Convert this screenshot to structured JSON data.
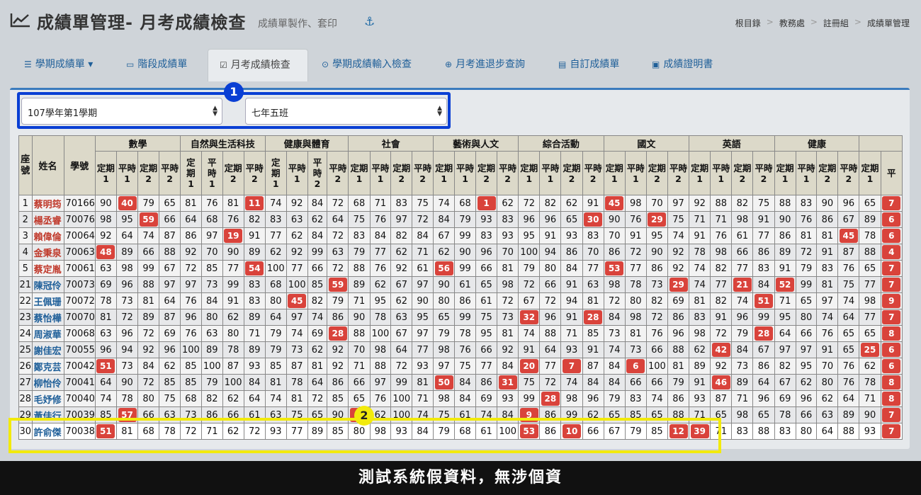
{
  "header": {
    "title": "成績單管理- 月考成績檢查",
    "subtitle": "成績單製作、套印",
    "anchor": "⚓",
    "crumbs": [
      "根目錄",
      "教務處",
      "註冊組",
      "成績單管理"
    ]
  },
  "tabs": [
    {
      "label": "學期成績單",
      "icon": "list-icon",
      "caret": "▾"
    },
    {
      "label": "階段成績單",
      "icon": "card-icon"
    },
    {
      "label": "月考成績檢查",
      "icon": "checkbox-icon"
    },
    {
      "label": "學期成績輸入檢查",
      "icon": "check-circle-icon"
    },
    {
      "label": "月考進退步查詢",
      "icon": "zoom-icon"
    },
    {
      "label": "自訂成績單",
      "icon": "form-icon"
    },
    {
      "label": "成績證明書",
      "icon": "id-icon"
    }
  ],
  "filters": {
    "term": "107學年第1學期",
    "klass": "七年五班"
  },
  "badges": {
    "one": "1",
    "two": "2"
  },
  "table": {
    "seat_header": "座號",
    "name_header": "姓名",
    "id_header": "學號",
    "subjects": [
      "數學",
      "自然與生活科技",
      "健康與體育",
      "社會",
      "藝術與人文",
      "綜合活動",
      "國文",
      "英語",
      "健康",
      ""
    ],
    "sub_headers": [
      "定期 1",
      "平時 1",
      "定期 2",
      "平時 2",
      "定 期 1",
      "平 時 1",
      "定期 2",
      "平時 2",
      "定 期 1",
      "平時 1",
      "平 時 2",
      "平時 2",
      "定期 1",
      "平時 1",
      "定期 2",
      "平時 2",
      "定期 1",
      "平時 1",
      "定期 2",
      "平時 2",
      "定期 1",
      "平時 1",
      "定期 2",
      "平時 2",
      "定期 1",
      "平時 1",
      "定期 2",
      "平時 2",
      "定期 1",
      "平時 1",
      "定期 2",
      "平時 2",
      "定期 1",
      "平時 1",
      "定期 2",
      "平時 2",
      "定期 1",
      "平"
    ],
    "rows": [
      {
        "seat": "1",
        "name": "蔡明筠",
        "id": "70166",
        "red": true,
        "scores": [
          "90",
          "40",
          "79",
          "65",
          "81",
          "76",
          "81",
          "11",
          "74",
          "92",
          "84",
          "72",
          "68",
          "71",
          "83",
          "75",
          "74",
          "68",
          "1",
          "62",
          "72",
          "82",
          "62",
          "91",
          "45",
          "98",
          "70",
          "97",
          "92",
          "88",
          "82",
          "75",
          "88",
          "83",
          "90",
          "96",
          "65",
          "7"
        ]
      },
      {
        "seat": "2",
        "name": "楊丞睿",
        "id": "70076",
        "red": true,
        "scores": [
          "98",
          "95",
          "59",
          "66",
          "64",
          "68",
          "76",
          "82",
          "83",
          "63",
          "62",
          "64",
          "75",
          "76",
          "97",
          "72",
          "84",
          "79",
          "93",
          "83",
          "96",
          "96",
          "65",
          "30",
          "90",
          "76",
          "29",
          "75",
          "71",
          "71",
          "98",
          "91",
          "90",
          "76",
          "86",
          "67",
          "89",
          "6"
        ]
      },
      {
        "seat": "3",
        "name": "賴偉倫",
        "id": "70064",
        "red": true,
        "scores": [
          "92",
          "64",
          "74",
          "87",
          "86",
          "97",
          "19",
          "91",
          "77",
          "62",
          "84",
          "72",
          "83",
          "84",
          "82",
          "84",
          "67",
          "99",
          "83",
          "93",
          "95",
          "91",
          "93",
          "83",
          "70",
          "91",
          "95",
          "74",
          "91",
          "76",
          "61",
          "77",
          "86",
          "81",
          "81",
          "45",
          "78",
          "6"
        ]
      },
      {
        "seat": "4",
        "name": "金秉泉",
        "id": "70063",
        "red": true,
        "scores": [
          "48",
          "89",
          "66",
          "88",
          "92",
          "70",
          "90",
          "89",
          "62",
          "92",
          "99",
          "63",
          "79",
          "77",
          "62",
          "71",
          "62",
          "90",
          "96",
          "70",
          "100",
          "94",
          "86",
          "70",
          "86",
          "72",
          "90",
          "92",
          "78",
          "98",
          "66",
          "86",
          "89",
          "72",
          "91",
          "87",
          "88",
          "4"
        ]
      },
      {
        "seat": "5",
        "name": "蔡定胤",
        "id": "70061",
        "red": true,
        "scores": [
          "63",
          "98",
          "99",
          "67",
          "72",
          "85",
          "77",
          "54",
          "100",
          "77",
          "66",
          "72",
          "88",
          "76",
          "92",
          "61",
          "56",
          "99",
          "66",
          "81",
          "79",
          "80",
          "84",
          "77",
          "53",
          "77",
          "86",
          "92",
          "74",
          "82",
          "77",
          "83",
          "91",
          "79",
          "83",
          "76",
          "65",
          "7"
        ]
      },
      {
        "seat": "21",
        "name": "陳冠伶",
        "id": "70073",
        "red": false,
        "scores": [
          "69",
          "96",
          "88",
          "97",
          "97",
          "73",
          "99",
          "83",
          "68",
          "100",
          "85",
          "59",
          "89",
          "62",
          "67",
          "97",
          "90",
          "61",
          "65",
          "98",
          "72",
          "66",
          "91",
          "63",
          "98",
          "78",
          "73",
          "29",
          "74",
          "77",
          "21",
          "84",
          "52",
          "99",
          "81",
          "75",
          "77",
          "7"
        ]
      },
      {
        "seat": "22",
        "name": "王佩珊",
        "id": "70072",
        "red": false,
        "scores": [
          "78",
          "73",
          "81",
          "64",
          "76",
          "84",
          "91",
          "83",
          "80",
          "45",
          "82",
          "79",
          "71",
          "95",
          "62",
          "90",
          "80",
          "86",
          "61",
          "72",
          "67",
          "72",
          "94",
          "81",
          "72",
          "80",
          "82",
          "69",
          "81",
          "82",
          "74",
          "51",
          "71",
          "65",
          "97",
          "74",
          "98",
          "9"
        ]
      },
      {
        "seat": "23",
        "name": "蔡怡樺",
        "id": "70070",
        "red": false,
        "scores": [
          "81",
          "72",
          "89",
          "87",
          "96",
          "80",
          "62",
          "89",
          "64",
          "97",
          "74",
          "86",
          "90",
          "78",
          "63",
          "95",
          "65",
          "99",
          "75",
          "73",
          "32",
          "96",
          "91",
          "28",
          "84",
          "98",
          "72",
          "86",
          "83",
          "91",
          "96",
          "99",
          "95",
          "80",
          "74",
          "64",
          "77",
          "7"
        ]
      },
      {
        "seat": "24",
        "name": "周淑華",
        "id": "70068",
        "red": false,
        "scores": [
          "63",
          "96",
          "72",
          "69",
          "76",
          "63",
          "80",
          "71",
          "79",
          "74",
          "69",
          "28",
          "88",
          "100",
          "67",
          "97",
          "79",
          "78",
          "95",
          "81",
          "74",
          "88",
          "71",
          "85",
          "73",
          "81",
          "76",
          "96",
          "98",
          "72",
          "79",
          "28",
          "64",
          "66",
          "76",
          "65",
          "65",
          "8"
        ]
      },
      {
        "seat": "25",
        "name": "謝佳宏",
        "id": "70055",
        "red": false,
        "scores": [
          "96",
          "94",
          "92",
          "96",
          "100",
          "89",
          "78",
          "89",
          "79",
          "73",
          "62",
          "92",
          "70",
          "98",
          "64",
          "77",
          "98",
          "76",
          "66",
          "92",
          "91",
          "64",
          "93",
          "91",
          "74",
          "73",
          "66",
          "88",
          "62",
          "42",
          "84",
          "67",
          "97",
          "97",
          "91",
          "65",
          "25",
          "6"
        ]
      },
      {
        "seat": "26",
        "name": "鄭克芸",
        "id": "70042",
        "red": false,
        "scores": [
          "51",
          "73",
          "84",
          "62",
          "85",
          "100",
          "87",
          "93",
          "85",
          "87",
          "81",
          "92",
          "71",
          "88",
          "72",
          "93",
          "97",
          "75",
          "77",
          "84",
          "20",
          "77",
          "7",
          "87",
          "84",
          "6",
          "100",
          "81",
          "89",
          "92",
          "73",
          "86",
          "82",
          "95",
          "70",
          "76",
          "62",
          "6"
        ]
      },
      {
        "seat": "27",
        "name": "柳怡伶",
        "id": "70041",
        "red": false,
        "scores": [
          "64",
          "90",
          "72",
          "85",
          "85",
          "79",
          "100",
          "84",
          "81",
          "78",
          "64",
          "86",
          "66",
          "97",
          "99",
          "81",
          "50",
          "84",
          "86",
          "31",
          "75",
          "72",
          "74",
          "84",
          "84",
          "66",
          "66",
          "79",
          "91",
          "46",
          "89",
          "64",
          "67",
          "62",
          "80",
          "76",
          "78",
          "8"
        ]
      },
      {
        "seat": "28",
        "name": "毛妤修",
        "id": "70040",
        "red": false,
        "scores": [
          "74",
          "78",
          "80",
          "75",
          "68",
          "82",
          "62",
          "64",
          "74",
          "81",
          "72",
          "85",
          "65",
          "76",
          "100",
          "71",
          "98",
          "84",
          "69",
          "93",
          "99",
          "28",
          "98",
          "96",
          "79",
          "83",
          "74",
          "86",
          "93",
          "87",
          "71",
          "96",
          "69",
          "96",
          "62",
          "64",
          "71",
          "8"
        ]
      },
      {
        "seat": "29",
        "name": "黃佳行",
        "id": "70039",
        "red": false,
        "scores": [
          "85",
          "57",
          "66",
          "63",
          "73",
          "86",
          "66",
          "61",
          "63",
          "75",
          "65",
          "90",
          "7",
          "62",
          "100",
          "74",
          "75",
          "61",
          "74",
          "84",
          "9",
          "86",
          "99",
          "62",
          "65",
          "85",
          "65",
          "88",
          "71",
          "65",
          "98",
          "65",
          "78",
          "66",
          "63",
          "89",
          "90",
          "7"
        ]
      },
      {
        "seat": "30",
        "name": "許俞傑",
        "id": "70038",
        "red": false,
        "hl": true,
        "scores": [
          "51",
          "81",
          "68",
          "78",
          "72",
          "71",
          "62",
          "72",
          "93",
          "77",
          "89",
          "85",
          "80",
          "98",
          "93",
          "84",
          "79",
          "68",
          "61",
          "100",
          "53",
          "86",
          "10",
          "66",
          "67",
          "79",
          "85",
          "12",
          "39",
          "71",
          "83",
          "88",
          "83",
          "80",
          "64",
          "88",
          "93",
          "7"
        ]
      }
    ]
  },
  "footer": "測試系統假資料，無涉個資"
}
